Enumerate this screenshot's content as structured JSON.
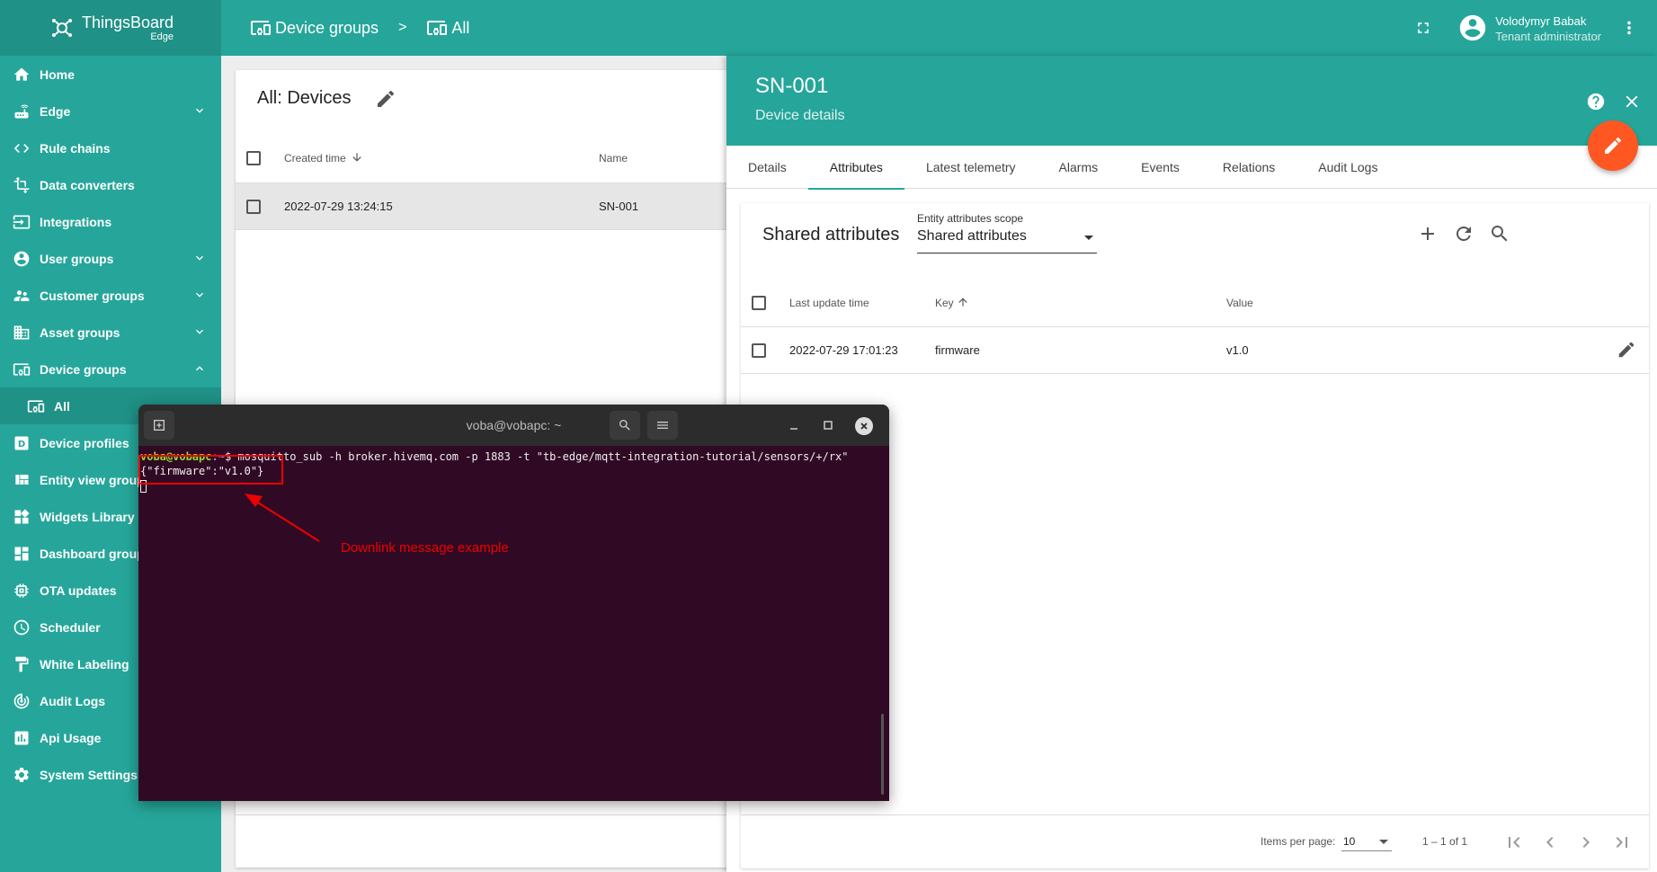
{
  "app": {
    "brand": "ThingsBoard",
    "brand_sub": "Edge"
  },
  "sidebar": {
    "items": [
      {
        "label": "Home",
        "icon": "home-icon"
      },
      {
        "label": "Edge",
        "icon": "router-icon",
        "chevron": "down"
      },
      {
        "label": "Rule chains",
        "icon": "code-icon"
      },
      {
        "label": "Data converters",
        "icon": "transform-icon"
      },
      {
        "label": "Integrations",
        "icon": "input-icon"
      },
      {
        "label": "User groups",
        "icon": "account-circle-icon",
        "chevron": "down"
      },
      {
        "label": "Customer groups",
        "icon": "supervisor-icon",
        "chevron": "down"
      },
      {
        "label": "Asset groups",
        "icon": "domain-icon",
        "chevron": "down"
      },
      {
        "label": "Device groups",
        "icon": "devices-icon",
        "chevron": "up"
      },
      {
        "label": "All",
        "icon": "devices-icon",
        "sub": true
      },
      {
        "label": "Device profiles",
        "icon": "device-profile-icon"
      },
      {
        "label": "Entity view groups",
        "icon": "view-quilt-icon"
      },
      {
        "label": "Widgets Library",
        "icon": "widgets-icon"
      },
      {
        "label": "Dashboard groups",
        "icon": "dashboard-icon"
      },
      {
        "label": "OTA updates",
        "icon": "memory-icon"
      },
      {
        "label": "Scheduler",
        "icon": "schedule-icon"
      },
      {
        "label": "White Labeling",
        "icon": "format-paint-icon"
      },
      {
        "label": "Audit Logs",
        "icon": "track-changes-icon"
      },
      {
        "label": "Api Usage",
        "icon": "insert-chart-icon"
      },
      {
        "label": "System Settings",
        "icon": "settings-icon"
      }
    ]
  },
  "topbar": {
    "crumb1": "Device groups",
    "crumb_sep": ">",
    "crumb2": "All",
    "user_name": "Volodymyr Babak",
    "user_role": "Tenant administrator"
  },
  "devices": {
    "title": "All: Devices",
    "col_created": "Created time",
    "col_name": "Name",
    "rows": [
      {
        "created": "2022-07-29 13:24:15",
        "name": "SN-001"
      }
    ]
  },
  "details": {
    "title": "SN-001",
    "subtitle": "Device details",
    "tabs": [
      "Details",
      "Attributes",
      "Latest telemetry",
      "Alarms",
      "Events",
      "Relations",
      "Audit Logs"
    ],
    "active_tab": "Attributes",
    "attributes": {
      "title": "Shared attributes",
      "scope_label": "Entity attributes scope",
      "scope_value": "Shared attributes",
      "col_last_update": "Last update time",
      "col_key": "Key",
      "col_value": "Value",
      "rows": [
        {
          "time": "2022-07-29 17:01:23",
          "key": "firmware",
          "value": "v1.0"
        }
      ],
      "items_per_page_label": "Items per page:",
      "items_per_page": "10",
      "range": "1 – 1 of 1"
    }
  },
  "terminal": {
    "title": "voba@vobapc: ~",
    "prompt_user": "voba@vobapc",
    "prompt_path": ":~",
    "prompt_symbol": "$",
    "command": " mosquitto_sub -h broker.hivemq.com -p 1883 -t \"tb-edge/mqtt-integration-tutorial/sensors/+/rx\"",
    "output": "{\"firmware\":\"v1.0\"}"
  },
  "annotation": {
    "text": "Downlink message example",
    "color": "#e00000"
  },
  "colors": {
    "primary": "#26a69a",
    "accent": "#ff5722",
    "terminal_bg": "#300a24"
  }
}
